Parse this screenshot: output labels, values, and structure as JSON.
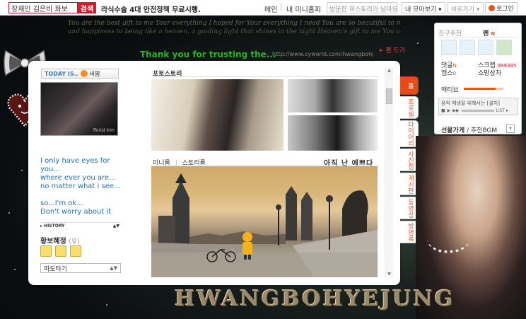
{
  "topbar": {
    "search_value": "장재인 김은비 화보",
    "search_button": "검색",
    "news_link": "라식수술 4대 안전정책 무료시행.",
    "nav_main": "메인",
    "nav_mini": "내 미니홈피",
    "visited_placeholder": "방문한 히스토리가 남아요",
    "mybox": "내 모아보기 ▾",
    "privacy": "비로가기 ▾",
    "login": "로그인"
  },
  "banner": {
    "scroll_line1": "You are the best gift to me  Your everything I hoped for  Your everything I need  You are so beautiful to me",
    "scroll_line2": "and happiness to being like a heaven, a guiding light that shines in the night  Heaven's gift to me  You are so beautiful to me",
    "thankyou": "Thank you for trusting the...",
    "url": "http://www.cyworld.com/hwangbohj",
    "paddy_link": "+ 편 드기"
  },
  "left": {
    "today_label": "TODAY IS..",
    "mood": "바쁨",
    "photo_caption": "florist kim",
    "intro_lines": [
      "I only have eyes for",
      "you...",
      "where ever you are...",
      "no matter what i see...",
      "",
      "so...I'm ok...",
      "Don't worry about it"
    ],
    "history_label": "▸ HISTORY",
    "history_arrows": "▲▼",
    "owner_name": "황보혜정",
    "owner_gender": "(♀)",
    "paddy_select": "파도타기",
    "paddy_arrow": "▲▼"
  },
  "center": {
    "photo_title": "포토스토리",
    "mini_tab1": "미니룸",
    "mini_tab2": "스토리룸",
    "mini_sep": "|",
    "mini_motto": "아직 난 예쁘다"
  },
  "tabs": [
    "홈",
    "프로필",
    "다이어리",
    "사진첩",
    "게시판",
    "동영상",
    "방명록"
  ],
  "right": {
    "recommend_label": "친구추천",
    "fan_label": "팬",
    "fan_new": "N",
    "comment_label": "댓글",
    "comment_new": "N",
    "app_label": "앱스",
    "app_new": "0",
    "scrap_label": "스크랩",
    "scrap_count": "999395",
    "gift_box_label": "소망상자",
    "activity_label": "액티브",
    "activity_level": 0.8,
    "music_line": "음악 재생을 위해서는 [설치]",
    "music_status": "LIST ▸",
    "gift_label": "선물가게",
    "bgm_label": " / 추천BGM",
    "gift_arrow": "▾",
    "brand_color": "#e8531a"
  },
  "footer": {
    "title": "HWANGBOHYEJUNG"
  }
}
